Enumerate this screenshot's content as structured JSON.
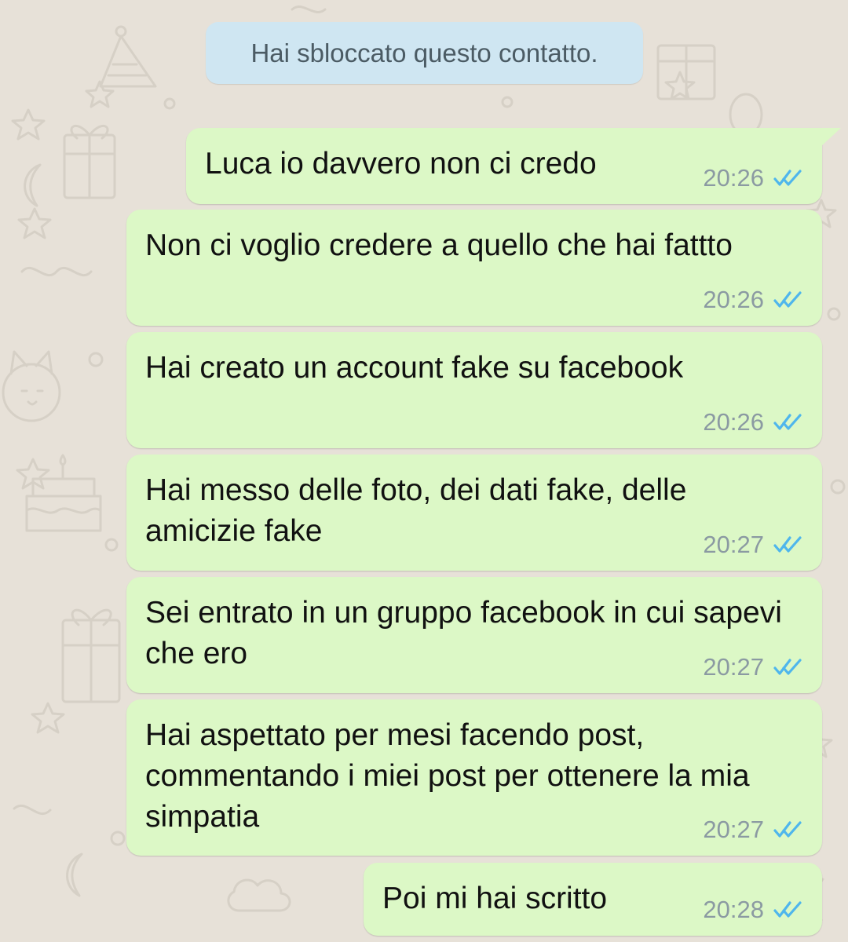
{
  "system_message": {
    "text": "Hai sbloccato questo contatto."
  },
  "messages": [
    {
      "text": "Luca io davvero non ci credo",
      "time": "20:26",
      "status_icon": "double-check-read-icon"
    },
    {
      "text": "Non ci voglio credere a quello che hai fattto",
      "time": "20:26",
      "status_icon": "double-check-read-icon"
    },
    {
      "text": "Hai creato un account fake su facebook",
      "time": "20:26",
      "status_icon": "double-check-read-icon"
    },
    {
      "text": "Hai messo delle foto, dei dati fake, delle amicizie fake",
      "time": "20:27",
      "status_icon": "double-check-read-icon"
    },
    {
      "text": "Sei entrato in un gruppo facebook in cui sapevi che ero",
      "time": "20:27",
      "status_icon": "double-check-read-icon"
    },
    {
      "text": "Hai aspettato per mesi facendo post, commentando i miei post per ottenere la mia simpatia",
      "time": "20:27",
      "status_icon": "double-check-read-icon"
    },
    {
      "text": "Poi mi hai scritto",
      "time": "20:28",
      "status_icon": "double-check-read-icon"
    }
  ],
  "colors": {
    "wallpaper": "#e7e1d8",
    "system_pill": "#cfe6f2",
    "outgoing_bubble": "#dcf8c6",
    "timestamp": "#8b9aa2",
    "read_receipt": "#4fb6ec"
  },
  "wallpaper": {
    "icons": [
      "star-icon",
      "moon-icon",
      "gift-icon",
      "cake-icon",
      "balloon-icon",
      "party-hat-icon",
      "cat-face-icon",
      "cloud-icon",
      "circle-icon"
    ]
  }
}
